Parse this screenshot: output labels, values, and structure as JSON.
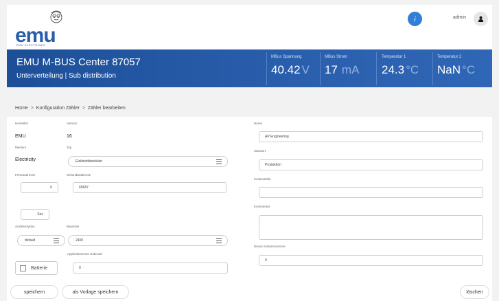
{
  "header": {
    "logo_text": "emu",
    "logo_sub": "EMU ELECTRONIC",
    "info_icon": "info-icon",
    "user_name": "admin",
    "user_icon": "user-icon"
  },
  "banner": {
    "title": "EMU M-BUS Center 87057",
    "subtitle": "Unterverteilung | Sub distribution",
    "meters": [
      {
        "label": "MBus Spannung",
        "value": "40.42",
        "unit": "V"
      },
      {
        "label": "MBus Strom",
        "value": "17",
        "unit": "mA"
      },
      {
        "label": "Temperatur 1",
        "value": "24.3",
        "unit": "°C"
      },
      {
        "label": "Temperatur 2",
        "value": "NaN",
        "unit": "°C"
      }
    ]
  },
  "breadcrumb": {
    "home": "Home",
    "sep": ">",
    "config": "Konfiguration Zähler",
    "edit": "Zähler bearbeiten"
  },
  "form": {
    "hersteller_label": "Hersteller",
    "hersteller_value": "EMU",
    "version_label": "Version",
    "version_value": "16",
    "medium_label": "Medium",
    "medium_value": "Electricity",
    "typ_label": "Typ",
    "typ_value": "Elektrizitätszähler",
    "primaer_label": "Primäradresse",
    "primaer_value": "0",
    "sekundaer_label": "Sekundäradresse",
    "sekundaer_value": "65687",
    "sec_value": "Sec",
    "auslese_label": "Auslesezyklus",
    "auslese_value": "default",
    "baud_label": "Baudrate",
    "baud_value": "2400",
    "appreset_label": "Applicationreset Subcode",
    "appreset_value": "0",
    "batterie_label": "Batterie",
    "name_label": "Name",
    "name_value": "AP Engineering",
    "standort_label": "Standort",
    "standort_value": "Produktion",
    "kostenstelle_label": "Kostenstelle",
    "kostenstelle_value": "",
    "kommentar_label": "Kommentar",
    "device_label": "Device Instanznummer",
    "device_value": "0"
  },
  "actions": {
    "save": "speichern",
    "save_template": "als Vorlage speichern",
    "delete": "löschen"
  },
  "colors": {
    "banner": "#2a5fae",
    "info": "#2f7fd6",
    "logo": "#2a5ea8"
  }
}
